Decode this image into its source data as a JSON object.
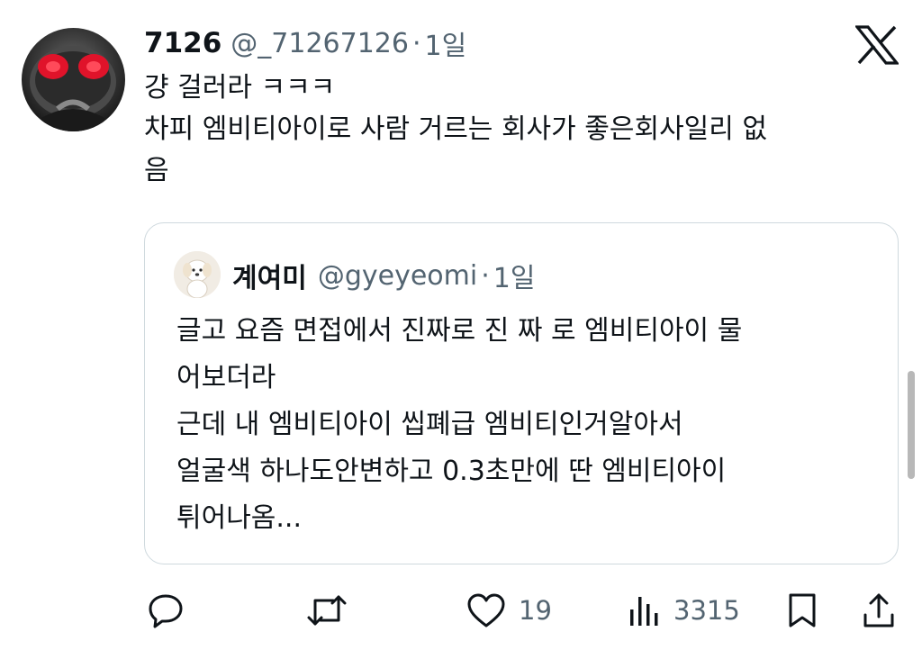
{
  "tweet": {
    "author": {
      "display_name": "7126",
      "handle": "@_71267126",
      "separator": "·",
      "time": "1일"
    },
    "platform_icon": "x-logo-icon",
    "text_lines": [
      "걍 걸러라 ㅋㅋㅋ",
      "차피 엠비티아이로 사람 거르는 회사가 좋은회사일리 없",
      "음"
    ],
    "quote": {
      "author": {
        "display_name": "계여미",
        "handle": "@gyeyeomi",
        "separator": "·",
        "time": "1일"
      },
      "text_lines": [
        "글고 요즘 면접에서 진짜로 진 짜 로 엠비티아이 물",
        "어보더라",
        "근데 내 엠비티아이 씹폐급 엠비티인거알아서",
        "얼굴색 하나도안변하고 0.3초만에 딴 엠비티아이",
        "튀어나옴..."
      ]
    },
    "actions": {
      "reply_icon": "reply-icon",
      "retweet_icon": "retweet-icon",
      "like_icon": "heart-icon",
      "like_count": "19",
      "views_icon": "views-icon",
      "views_count": "3315",
      "bookmark_icon": "bookmark-icon",
      "share_icon": "share-icon"
    },
    "colors": {
      "text_primary": "#0f1419",
      "text_secondary": "#536471",
      "border": "#cfd9de",
      "avatar_eye": "#e0132a"
    }
  }
}
